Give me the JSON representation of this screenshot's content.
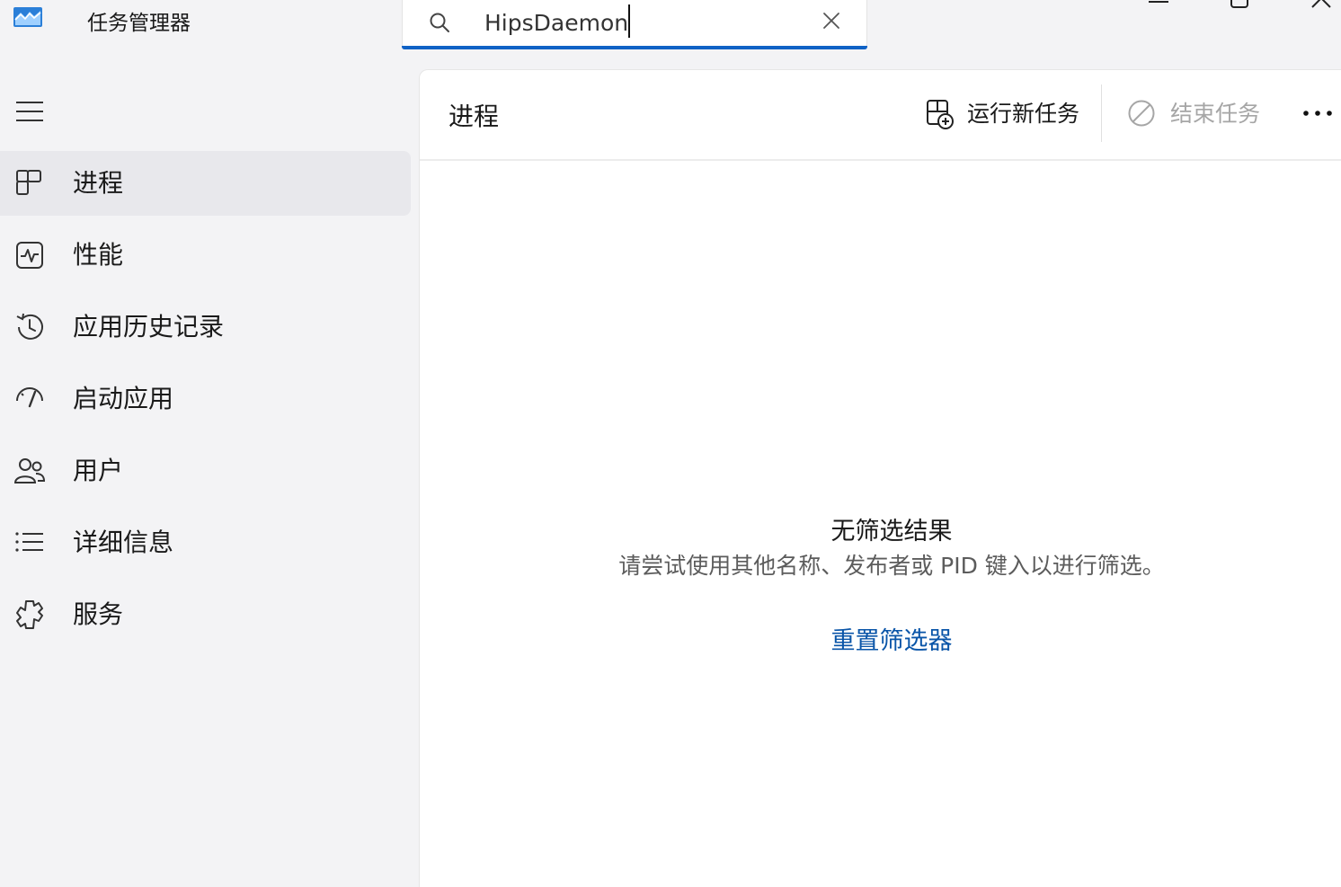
{
  "window": {
    "title": "任务管理器",
    "accent_color": "#0f62c5"
  },
  "search": {
    "value": "HipsDaemon",
    "icon": "search-icon",
    "clear_icon": "close-icon"
  },
  "sidebar": {
    "menu_icon": "hamburger-icon",
    "items": [
      {
        "label": "进程",
        "icon": "processes-icon",
        "active": true
      },
      {
        "label": "性能",
        "icon": "performance-icon",
        "active": false
      },
      {
        "label": "应用历史记录",
        "icon": "history-icon",
        "active": false
      },
      {
        "label": "启动应用",
        "icon": "startup-icon",
        "active": false
      },
      {
        "label": "用户",
        "icon": "users-icon",
        "active": false
      },
      {
        "label": "详细信息",
        "icon": "details-icon",
        "active": false
      },
      {
        "label": "服务",
        "icon": "services-icon",
        "active": false
      }
    ]
  },
  "main": {
    "title": "进程",
    "toolbar": {
      "run_new_task_label": "运行新任务",
      "end_task_label": "结束任务",
      "end_task_disabled": true
    },
    "empty_state": {
      "title": "无筛选结果",
      "description": "请尝试使用其他名称、发布者或 PID 键入以进行筛选。",
      "reset_link": "重置筛选器",
      "link_color": "#0a55a8"
    }
  }
}
